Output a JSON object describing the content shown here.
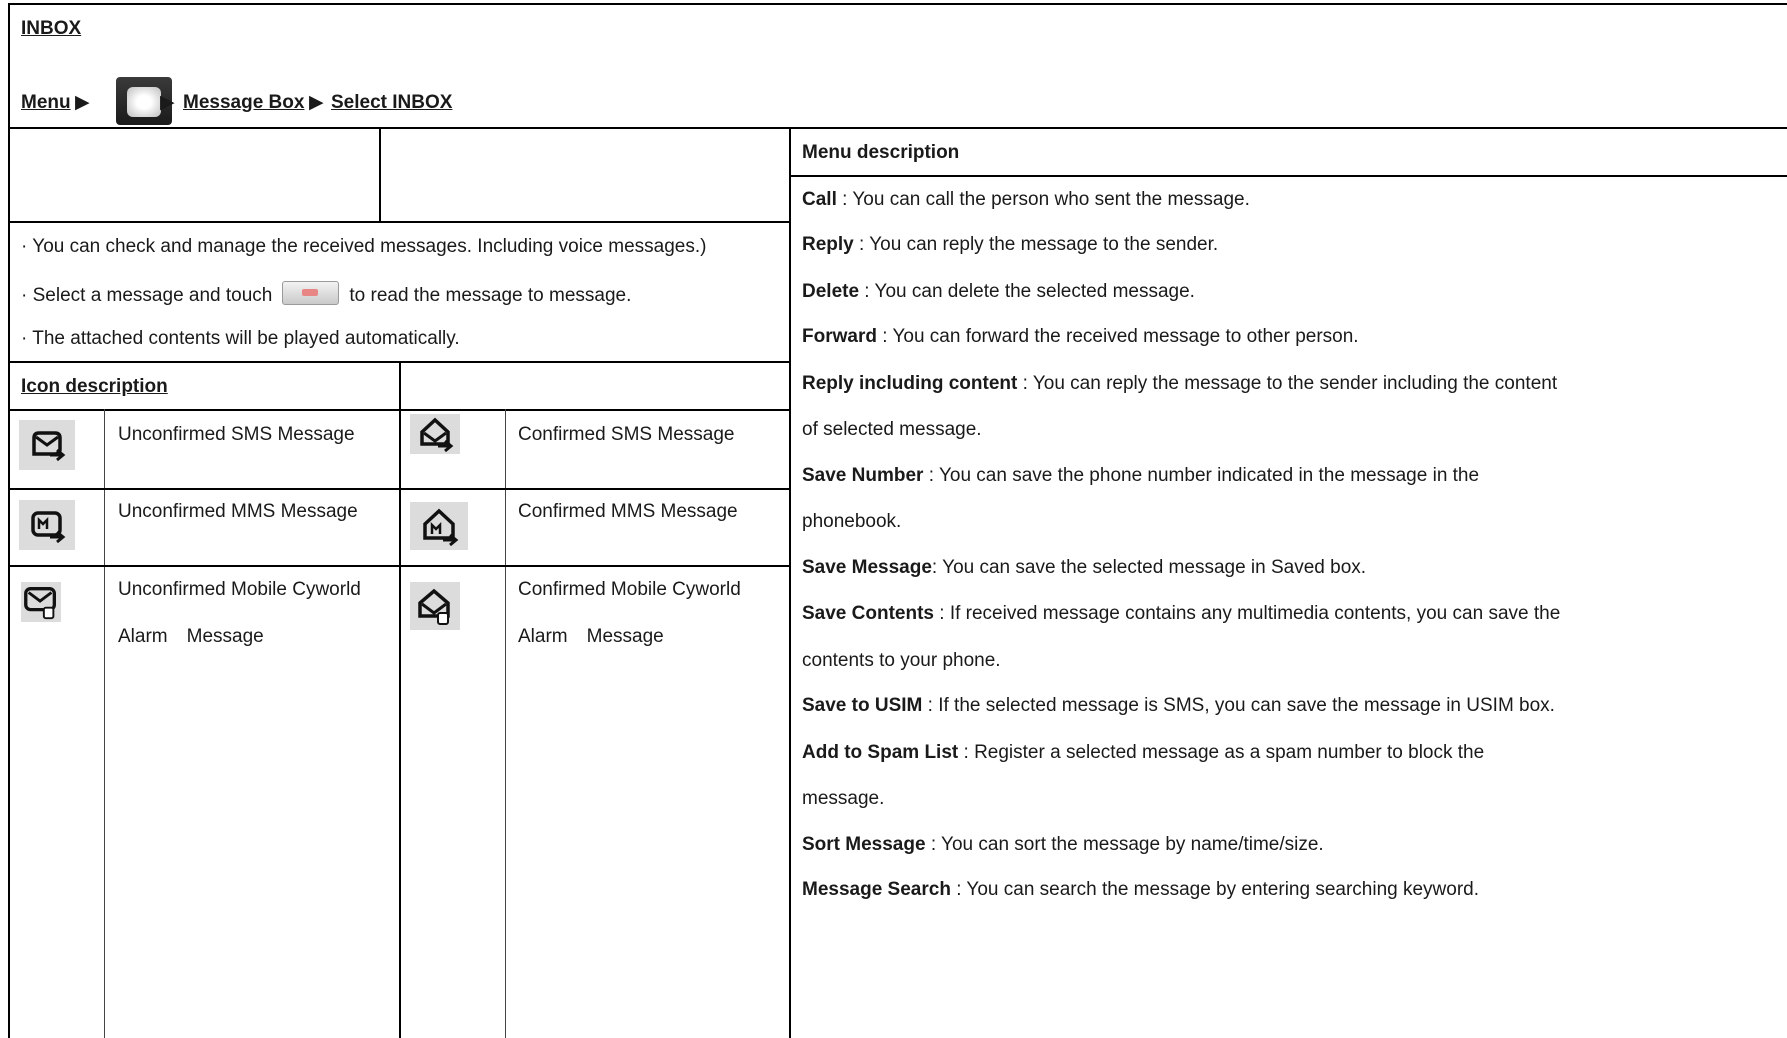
{
  "header": {
    "title": "INBOX",
    "breadcrumb": {
      "menu": "Menu",
      "arrow1": "▶",
      "arrow2": "▶",
      "message_box": "Message Box",
      "arrow3": "▶",
      "select_inbox": "Select INBOX"
    }
  },
  "intro": {
    "line1": "· You can check and manage the received messages. Including voice messages.)",
    "line2_before": "· Select a message and touch",
    "line2_after": "to read the message to message.",
    "line3": "· The attached contents will be played automatically."
  },
  "icon_description": {
    "heading": "Icon description",
    "rows": [
      {
        "left_label": "Unconfirmed SMS Message",
        "left_icon": "envelope-arrow-icon",
        "right_label": "Confirmed SMS Message",
        "right_icon": "open-envelope-arrow-icon"
      },
      {
        "left_label": "Unconfirmed MMS Message",
        "left_icon": "mms-envelope-icon",
        "right_label": "Confirmed MMS Message",
        "right_icon": "open-mms-envelope-icon"
      },
      {
        "left_label_1": "Unconfirmed Mobile Cyworld",
        "left_label_2": "Alarm　Message",
        "left_icon": "cyworld-envelope-icon",
        "right_label_1": "Confirmed Mobile Cyworld",
        "right_label_2": "Alarm　Message",
        "right_icon": "open-cyworld-envelope-icon"
      }
    ]
  },
  "menu_description": {
    "heading": "Menu description",
    "items": [
      {
        "term": "Call",
        "sep": " : ",
        "text": "You can call the person who sent the message."
      },
      {
        "term": "Reply",
        "sep": " : ",
        "text": "You can reply the message to the sender."
      },
      {
        "term": "Delete",
        "sep": " : ",
        "text": "You can delete the selected message."
      },
      {
        "term": "Forward",
        "sep": " : ",
        "text": "You can forward the received message to other person."
      },
      {
        "term": "Reply including content",
        "sep": " : ",
        "text": "You can reply the message to the sender including the content",
        "cont": "of selected message."
      },
      {
        "term": "Save Number",
        "sep": " : ",
        "text": "You can save the phone number indicated in the message in the",
        "cont": "phonebook."
      },
      {
        "term": "Save Message",
        "sep": ": ",
        "text": "You can save the selected message in Saved box."
      },
      {
        "term": "Save Contents",
        "sep": " : ",
        "text": "If received message contains any multimedia contents, you can save the",
        "cont": "contents to your phone."
      },
      {
        "term": "Save to USIM",
        "sep": " : ",
        "text": "If the selected message is SMS, you can save the message in USIM box."
      },
      {
        "term": "Add to Spam List",
        "sep": " : ",
        "text": "Register a selected message as a spam number to block the",
        "cont": "message."
      },
      {
        "term": "Sort Message",
        "sep": " : ",
        "text": "You can sort the message by name/time/size."
      },
      {
        "term": "Message Search",
        "sep": " : ",
        "text": "You can search the message by entering searching keyword."
      }
    ]
  },
  "colors": {
    "border": "#000000",
    "icon_bg": "#dcdcdc",
    "icon_stroke": "#111111"
  }
}
